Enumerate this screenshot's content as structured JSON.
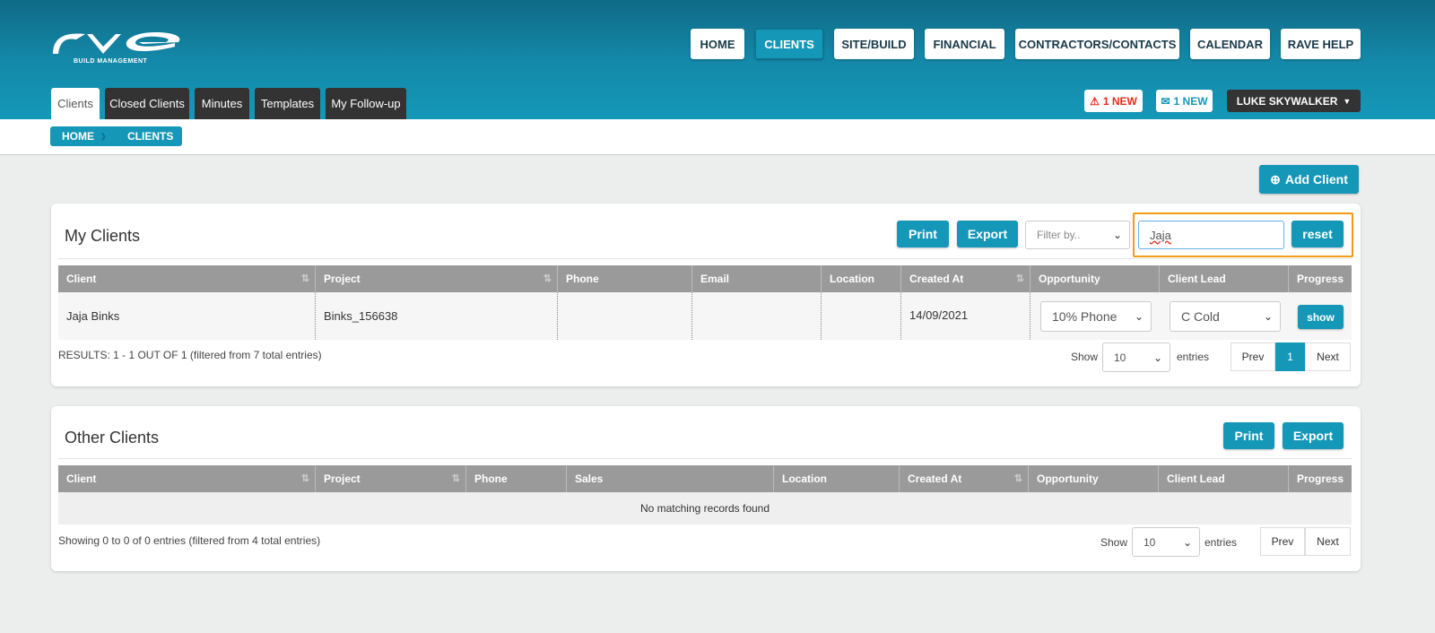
{
  "logo": {
    "text": "rave",
    "subtitle": "BUILD MANAGEMENT"
  },
  "nav": [
    "HOME",
    "CLIENTS",
    "SITE/BUILD",
    "FINANCIAL",
    "CONTRACTORS/CONTACTS",
    "CALENDAR",
    "RAVE HELP"
  ],
  "tabs": [
    "Clients",
    "Closed Clients",
    "Minutes",
    "Templates",
    "My Follow-up"
  ],
  "alerts": {
    "warning": "1 NEW",
    "mail": "1 NEW"
  },
  "user": "LUKE SKYWALKER",
  "breadcrumb": [
    "HOME",
    "CLIENTS"
  ],
  "add_client": "Add Client",
  "colors": {
    "accent": "#1597b7",
    "highlight": "#f39c12",
    "warning": "#e52b1b"
  },
  "my_clients": {
    "title": "My Clients",
    "print": "Print",
    "export": "Export",
    "filter_placeholder": "Filter by..",
    "search_value": "Jaja",
    "reset": "reset",
    "columns": [
      "Client",
      "Project",
      "Phone",
      "Email",
      "Location",
      "Created At",
      "Opportunity",
      "Client Lead",
      "Progress"
    ],
    "rows": [
      {
        "client": "Jaja Binks",
        "project": "Binks_156638",
        "phone": "",
        "email": "",
        "location": "",
        "created": "14/09/2021",
        "opportunity": "10% Phone",
        "lead": "C Cold",
        "progress": "show"
      }
    ],
    "results": "RESULTS: 1 - 1 OUT OF 1 (filtered from 7 total entries)",
    "show": "Show",
    "page_size": "10",
    "entries": "entries",
    "prev": "Prev",
    "page": "1",
    "next": "Next"
  },
  "other_clients": {
    "title": "Other Clients",
    "print": "Print",
    "export": "Export",
    "columns": [
      "Client",
      "Project",
      "Phone",
      "Sales",
      "Location",
      "Created At",
      "Opportunity",
      "Client Lead",
      "Progress"
    ],
    "empty": "No matching records found",
    "results": "Showing 0 to 0 of 0 entries (filtered from 4 total entries)",
    "show": "Show",
    "page_size": "10",
    "entries": "entries",
    "prev": "Prev",
    "next": "Next"
  }
}
